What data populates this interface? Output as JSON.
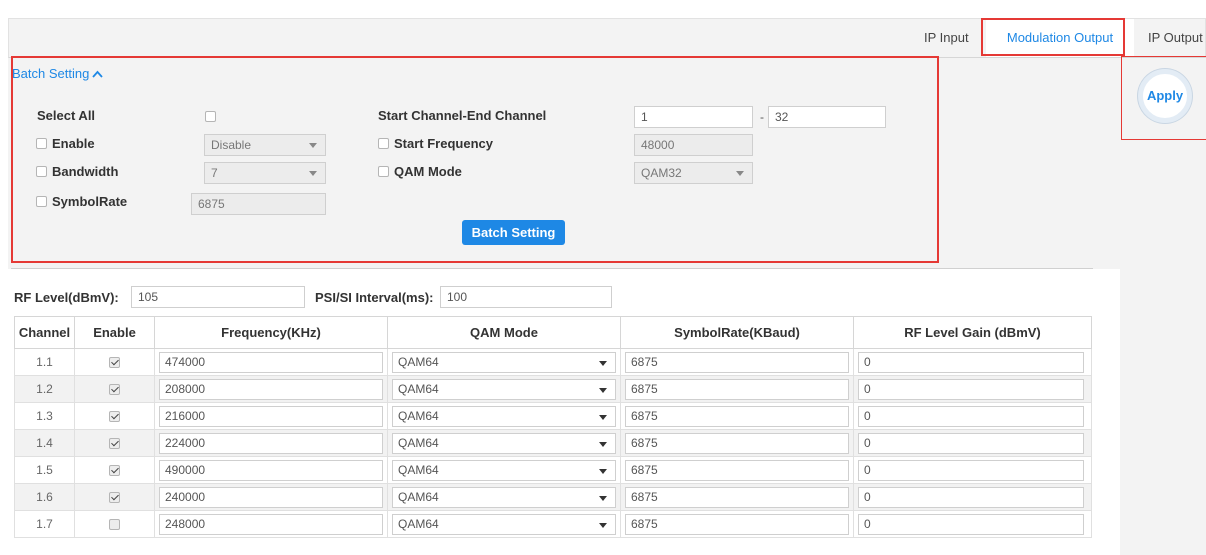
{
  "tabs": [
    {
      "label": "IP Input",
      "active": false
    },
    {
      "label": "Modulation Output",
      "active": true
    },
    {
      "label": "IP Output",
      "active": false
    }
  ],
  "batch": {
    "toggle_label": "Batch Setting",
    "select_all_label": "Select All",
    "enable_label": "Enable",
    "enable_value": "Disable",
    "bandwidth_label": "Bandwidth",
    "bandwidth_value": "7",
    "symbolrate_label": "SymbolRate",
    "symbolrate_value": "6875",
    "channel_range_label": "Start Channel-End Channel",
    "start_channel": "1",
    "range_dash": "-",
    "end_channel": "32",
    "start_freq_label": "Start Frequency",
    "start_freq_value": "48000",
    "qam_label": "QAM Mode",
    "qam_value": "QAM32",
    "button_label": "Batch Setting"
  },
  "apply_label": "Apply",
  "rf": {
    "rf_level_label": "RF Level(dBmV):",
    "rf_level_value": "105",
    "psi_label": "PSI/SI Interval(ms):",
    "psi_value": "100"
  },
  "table": {
    "headers": [
      "Channel",
      "Enable",
      "Frequency(KHz)",
      "QAM Mode",
      "SymbolRate(KBaud)",
      "RF Level Gain (dBmV)"
    ],
    "rows": [
      {
        "channel": "1.1",
        "enabled": true,
        "freq": "474000",
        "qam": "QAM64",
        "symbol": "6875",
        "gain": "0"
      },
      {
        "channel": "1.2",
        "enabled": true,
        "freq": "208000",
        "qam": "QAM64",
        "symbol": "6875",
        "gain": "0"
      },
      {
        "channel": "1.3",
        "enabled": true,
        "freq": "216000",
        "qam": "QAM64",
        "symbol": "6875",
        "gain": "0"
      },
      {
        "channel": "1.4",
        "enabled": true,
        "freq": "224000",
        "qam": "QAM64",
        "symbol": "6875",
        "gain": "0"
      },
      {
        "channel": "1.5",
        "enabled": true,
        "freq": "490000",
        "qam": "QAM64",
        "symbol": "6875",
        "gain": "0"
      },
      {
        "channel": "1.6",
        "enabled": true,
        "freq": "240000",
        "qam": "QAM64",
        "symbol": "6875",
        "gain": "0"
      },
      {
        "channel": "1.7",
        "enabled": false,
        "freq": "248000",
        "qam": "QAM64",
        "symbol": "6875",
        "gain": "0"
      }
    ]
  },
  "colors": {
    "accent": "#1e88e5",
    "highlight_border": "#e53935"
  }
}
